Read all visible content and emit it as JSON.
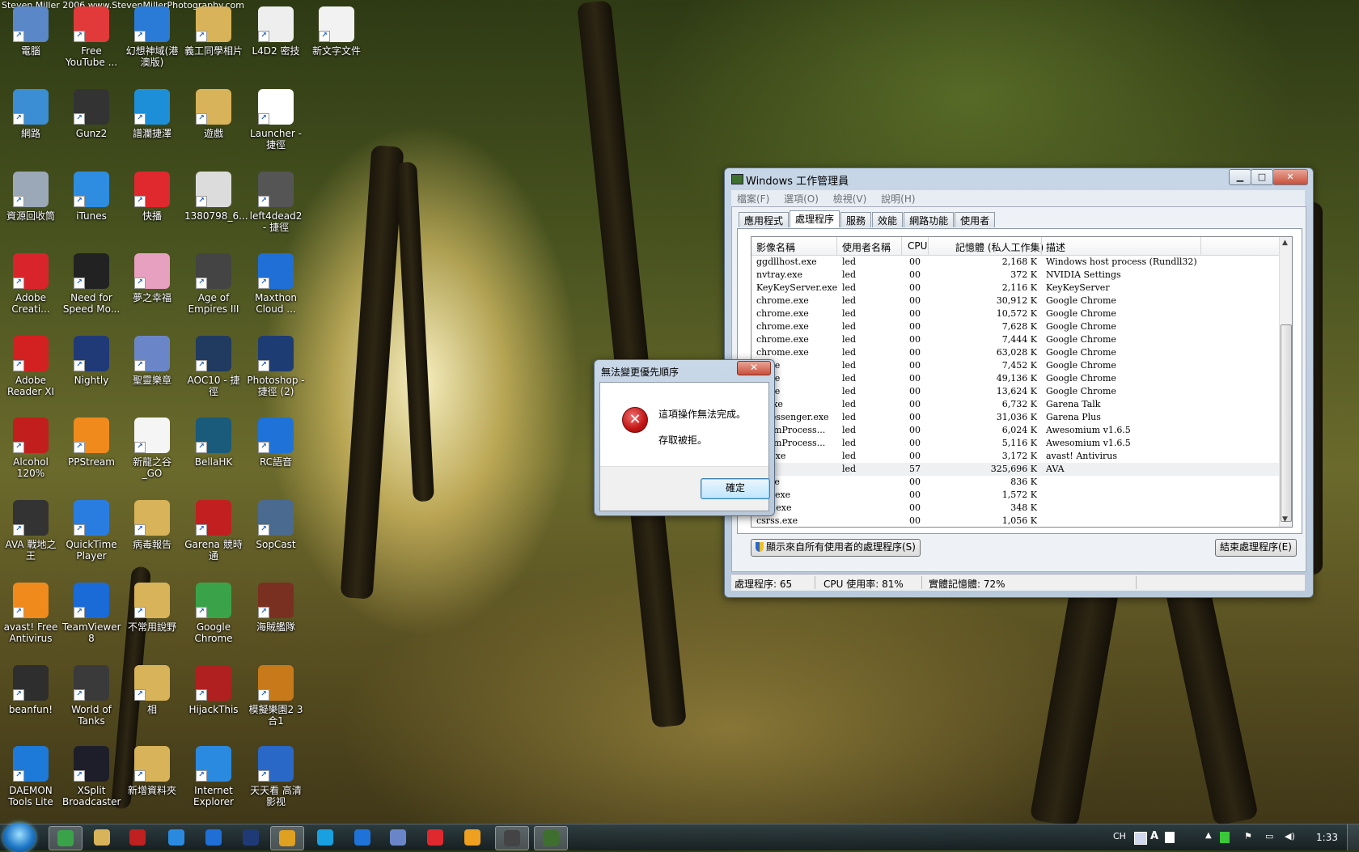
{
  "wallpaper_credit": "Steven Miller 2006 www.StevenMillerPhotography.com",
  "desktop_icons": [
    {
      "label": "電腦",
      "color": "#5a87c8"
    },
    {
      "label": "Free YouTube ...",
      "color": "#e23a3a"
    },
    {
      "label": "幻想神域(港澳版)",
      "color": "#2a7ad8"
    },
    {
      "label": "義工同學相片",
      "color": "#d8b35a"
    },
    {
      "label": "L4D2 密技",
      "color": "#eeeeee"
    },
    {
      "label": "新文字文件",
      "color": "#f2f2f2"
    },
    {
      "label": "網路",
      "color": "#3b8dd4"
    },
    {
      "label": "Gunz2",
      "color": "#333333"
    },
    {
      "label": "譜瀾捷澤",
      "color": "#1d8fd8"
    },
    {
      "label": "遊戲",
      "color": "#d8b35a"
    },
    {
      "label": "Launcher - 捷徑",
      "color": "#ffffff"
    },
    {
      "label": "資源回收筒",
      "color": "#9aa8b8"
    },
    {
      "label": "iTunes",
      "color": "#2e8de0"
    },
    {
      "label": "快播",
      "color": "#e0292f"
    },
    {
      "label": "1380798_6...",
      "color": "#dcdcdc"
    },
    {
      "label": "left4dead2 - 捷徑",
      "color": "#555555"
    },
    {
      "label": "Adobe Creati...",
      "color": "#d9242b"
    },
    {
      "label": "Need for Speed Mo...",
      "color": "#222222"
    },
    {
      "label": "夢之幸福",
      "color": "#e8a0c0"
    },
    {
      "label": "Age of Empires III",
      "color": "#444444"
    },
    {
      "label": "Maxthon Cloud ...",
      "color": "#1f6fd6"
    },
    {
      "label": "Adobe Reader XI",
      "color": "#d32020"
    },
    {
      "label": "Nightly",
      "color": "#203a78"
    },
    {
      "label": "聖靈樂章",
      "color": "#6b86c8"
    },
    {
      "label": "AOC10 - 捷徑",
      "color": "#203a60"
    },
    {
      "label": "Photoshop - 捷徑 (2)",
      "color": "#1e3c74"
    },
    {
      "label": "Alcohol 120%",
      "color": "#c21e1e"
    },
    {
      "label": "PPStream",
      "color": "#f08a1c"
    },
    {
      "label": "新龍之谷_GO",
      "color": "#f5f5f5"
    },
    {
      "label": "BellaHK",
      "color": "#1a5a7a"
    },
    {
      "label": "RC語音",
      "color": "#1f73d8"
    },
    {
      "label": "AVA 戰地之王",
      "color": "#333333"
    },
    {
      "label": "QuickTime Player",
      "color": "#2a7de0"
    },
    {
      "label": "病毒報告",
      "color": "#d8b35a"
    },
    {
      "label": "Garena 競時通",
      "color": "#c22020"
    },
    {
      "label": "SopCast",
      "color": "#4a6a90"
    },
    {
      "label": "avast! Free Antivirus",
      "color": "#f08a1c"
    },
    {
      "label": "TeamViewer 8",
      "color": "#1a6ad8"
    },
    {
      "label": "不常用說野",
      "color": "#d8b35a"
    },
    {
      "label": "Google Chrome",
      "color": "#3aa34a"
    },
    {
      "label": "海賊艦隊",
      "color": "#7a3020"
    },
    {
      "label": "beanfun!",
      "color": "#2e2e2e"
    },
    {
      "label": "World of Tanks",
      "color": "#3a3a3a"
    },
    {
      "label": "相",
      "color": "#d8b35a"
    },
    {
      "label": "HijackThis",
      "color": "#b02020"
    },
    {
      "label": "模擬樂園2 3合1",
      "color": "#c87a1a"
    },
    {
      "label": "DAEMON Tools Lite",
      "color": "#1d7ad8"
    },
    {
      "label": "XSplit Broadcaster",
      "color": "#1e1e2a"
    },
    {
      "label": "新增資料夾",
      "color": "#d8b35a"
    },
    {
      "label": "Internet Explorer",
      "color": "#2a8ae0"
    },
    {
      "label": "天天看 高清影视",
      "color": "#2a68c8"
    }
  ],
  "task_manager": {
    "title": "Windows 工作管理員",
    "window_buttons": {
      "minimize": "▁",
      "maximize": "□",
      "close": "✕"
    },
    "menu": [
      "檔案(F)",
      "選項(O)",
      "檢視(V)",
      "說明(H)"
    ],
    "tabs": [
      "應用程式",
      "處理程序",
      "服務",
      "效能",
      "網路功能",
      "使用者"
    ],
    "active_tab": "處理程序",
    "columns": [
      "影像名稱",
      "使用者名稱",
      "CPU",
      "記憶體 (私人工作集)",
      "描述"
    ],
    "rows": [
      {
        "name": "ggdllhost.exe",
        "user": "led",
        "cpu": "00",
        "mem": "2,168 K",
        "desc": "Windows host process (Rundll32)"
      },
      {
        "name": "nvtray.exe",
        "user": "led",
        "cpu": "00",
        "mem": "372 K",
        "desc": "NVIDIA Settings"
      },
      {
        "name": "KeyKeyServer.exe",
        "user": "led",
        "cpu": "00",
        "mem": "2,116 K",
        "desc": "KeyKeyServer"
      },
      {
        "name": "chrome.exe",
        "user": "led",
        "cpu": "00",
        "mem": "30,912 K",
        "desc": "Google Chrome"
      },
      {
        "name": "chrome.exe",
        "user": "led",
        "cpu": "00",
        "mem": "10,572 K",
        "desc": "Google Chrome"
      },
      {
        "name": "chrome.exe",
        "user": "led",
        "cpu": "00",
        "mem": "7,628 K",
        "desc": "Google Chrome"
      },
      {
        "name": "chrome.exe",
        "user": "led",
        "cpu": "00",
        "mem": "7,444 K",
        "desc": "Google Chrome"
      },
      {
        "name": "chrome.exe",
        "user": "led",
        "cpu": "00",
        "mem": "63,028 K",
        "desc": "Google Chrome"
      },
      {
        "name": "e.exe",
        "user": "led",
        "cpu": "00",
        "mem": "7,452 K",
        "desc": "Google Chrome"
      },
      {
        "name": "e.exe",
        "user": "led",
        "cpu": "00",
        "mem": "49,136 K",
        "desc": "Google Chrome"
      },
      {
        "name": "e.exe",
        "user": "led",
        "cpu": "00",
        "mem": "13,624 K",
        "desc": "Google Chrome"
      },
      {
        "name": "lk.exe",
        "user": "led",
        "cpu": "00",
        "mem": "6,732 K",
        "desc": "Garena Talk"
      },
      {
        "name": "aMessenger.exe",
        "user": "led",
        "cpu": "00",
        "mem": "31,036 K",
        "desc": "Garena Plus"
      },
      {
        "name": "miumProcess...",
        "user": "led",
        "cpu": "00",
        "mem": "6,024 K",
        "desc": "Awesomium v1.6.5"
      },
      {
        "name": "miumProcess...",
        "user": "led",
        "cpu": "00",
        "mem": "5,116 K",
        "desc": "Awesomium v1.6.5"
      },
      {
        "name": "UI.exe",
        "user": "led",
        "cpu": "00",
        "mem": "3,172 K",
        "desc": "avast! Antivirus"
      },
      {
        "name": "exe",
        "user": "led",
        "cpu": "57",
        "mem": "325,696 K",
        "desc": "AVA"
      },
      {
        "name": "c.exe",
        "user": "",
        "cpu": "00",
        "mem": "836 K",
        "desc": ""
      },
      {
        "name": "ync.exe",
        "user": "",
        "cpu": "00",
        "mem": "1,572 K",
        "desc": ""
      },
      {
        "name": "gon.exe",
        "user": "",
        "cpu": "00",
        "mem": "348 K",
        "desc": ""
      },
      {
        "name": "csrss.exe",
        "user": "",
        "cpu": "00",
        "mem": "1,056 K",
        "desc": ""
      }
    ],
    "selected_row": 16,
    "show_all_button": "顯示來自所有使用者的處理程序(S)",
    "end_process_button": "結束處理程序(E)",
    "status": {
      "processes": "處理程序: 65",
      "cpu": "CPU 使用率: 81%",
      "memory": "實體記憶體: 72%"
    }
  },
  "error_dialog": {
    "title": "無法變更優先順序",
    "close": "✕",
    "message1": "這項操作無法完成。",
    "message2": "存取被拒。",
    "ok": "確定"
  },
  "taskbar": {
    "apps": [
      {
        "name": "chrome",
        "color": "#3aa34a",
        "active": true
      },
      {
        "name": "explorer",
        "color": "#d8b35a",
        "active": false
      },
      {
        "name": "media",
        "color": "#c02020",
        "active": false
      },
      {
        "name": "ie",
        "color": "#2a8ae0",
        "active": false
      },
      {
        "name": "maxthon",
        "color": "#1f6fd6",
        "active": false
      },
      {
        "name": "nightly",
        "color": "#203a78",
        "active": false
      },
      {
        "name": "folder-player",
        "color": "#e0a020",
        "active": true
      },
      {
        "name": "skype",
        "color": "#18a0e0",
        "active": false
      },
      {
        "name": "rc",
        "color": "#1f73d8",
        "active": false
      },
      {
        "name": "game",
        "color": "#6b86c8",
        "active": false
      },
      {
        "name": "qvod",
        "color": "#e0292f",
        "active": false
      },
      {
        "name": "qq",
        "color": "#f0a020",
        "active": false
      },
      {
        "name": "ava",
        "color": "#444444",
        "active": true
      },
      {
        "name": "task-manager",
        "color": "#3f6f2e",
        "active": true
      }
    ],
    "tray_lang": "CH",
    "clock": "1:33"
  }
}
